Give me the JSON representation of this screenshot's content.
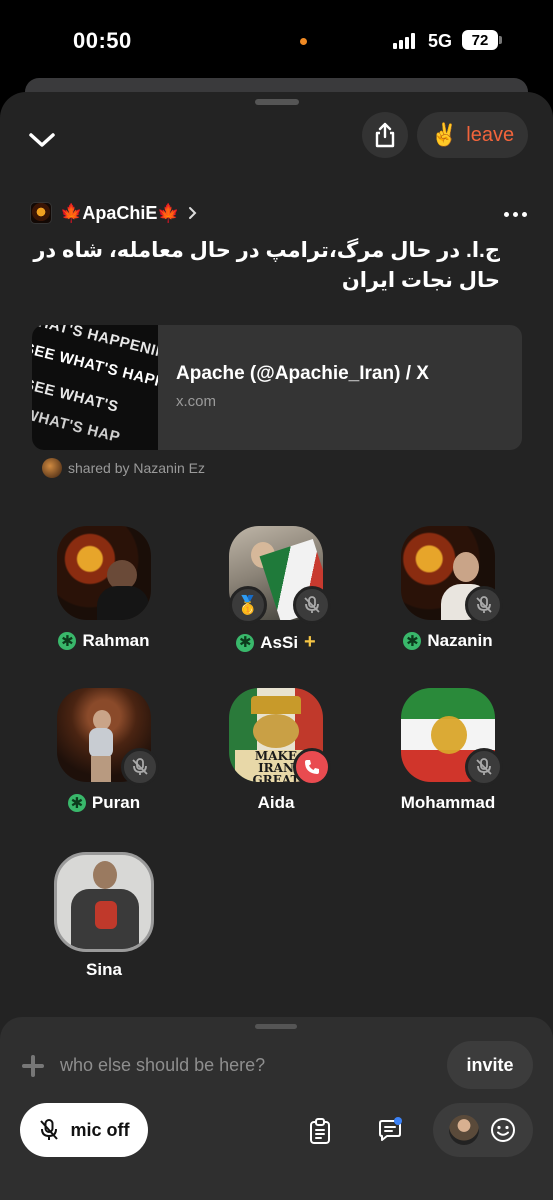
{
  "status_bar": {
    "time": "00:50",
    "network": "5G",
    "battery": "72"
  },
  "header": {
    "leave_emoji": "✌️",
    "leave_label": "leave"
  },
  "room": {
    "club_name": "🍁ApaChiE🍁",
    "title": "ج.ا. در حال مرگ،ترامپ در حال معامله، شاه در حال نجات ایران"
  },
  "link_card": {
    "thumb_text": "SEE WHAT'S HAPPENING",
    "title": "Apache (@Apachie_Iran) / X",
    "domain": "x.com",
    "shared_by": "shared by Nazanin Ez"
  },
  "speakers": [
    {
      "name": "Rahman",
      "moderator": true
    },
    {
      "name": "AsSi",
      "moderator": true,
      "plus": "+",
      "muted": true,
      "medal": "🥇"
    },
    {
      "name": "Nazanin",
      "moderator": true,
      "muted": true
    },
    {
      "name": "Puran",
      "moderator": true,
      "muted": true
    },
    {
      "name": "Aida",
      "moderator": false,
      "calling": true,
      "art_text": "MAKE IRAN GREAT AGAIN"
    },
    {
      "name": "Mohammad",
      "moderator": false,
      "muted": true
    },
    {
      "name": "Sina",
      "moderator": false
    }
  ],
  "bottom_bar": {
    "suggest_placeholder": "who else should be here?",
    "invite_label": "invite",
    "mic_label": "mic off"
  },
  "colors": {
    "background": "#232323",
    "leave": "#f2643b",
    "moderator": "#39b86b",
    "call": "#e94b50",
    "notify": "#3b82f6"
  }
}
